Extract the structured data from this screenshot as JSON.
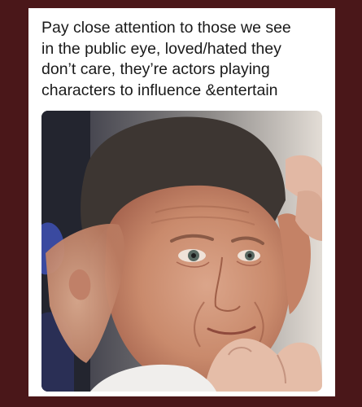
{
  "post": {
    "caption": "Pay close attention to those we see\nin the public eye, loved/hated they\ndon’t care, they’re actors playing\ncharacters to influence &entertain"
  },
  "colors": {
    "frame": "#4a1719",
    "card": "#ffffff",
    "caption_text": "#1a1a1a"
  }
}
